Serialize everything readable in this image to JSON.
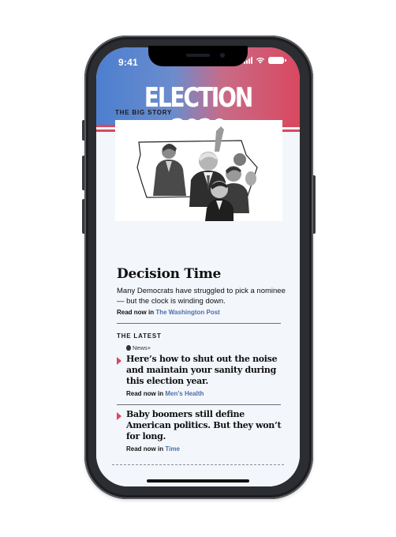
{
  "status_bar": {
    "time": "9:41"
  },
  "header": {
    "masthead": "ELECTION 2020",
    "gradient_colors": [
      "#4c7fcf",
      "#d9485f"
    ]
  },
  "big_story": {
    "section_label": "THE BIG STORY",
    "image_alt": "Collage of candidates over a map of Iowa",
    "headline": "Decision Time",
    "dek": "Many Democrats have struggled to pick a nominee — but the clock is winding down.",
    "read_now_prefix": "Read now in",
    "publication": "The Washington Post"
  },
  "latest": {
    "section_label": "THE LATEST",
    "badge": "News+",
    "items": [
      {
        "title": "Here’s how to shut out the noise and maintain your sanity during this election year.",
        "read_now_prefix": "Read now in",
        "publication": "Men’s Health"
      },
      {
        "title": "Baby boomers still define American politics. But they won’t for long.",
        "read_now_prefix": "Read now in",
        "publication": "Time"
      }
    ]
  },
  "colors": {
    "accent_red": "#d9485f",
    "link_blue": "#4b6fae",
    "phone_frame": "#2c2d31"
  },
  "icons": [
    "signal-icon",
    "wifi-icon",
    "battery-icon",
    "apple-logo-icon",
    "triangle-marker-icon"
  ]
}
